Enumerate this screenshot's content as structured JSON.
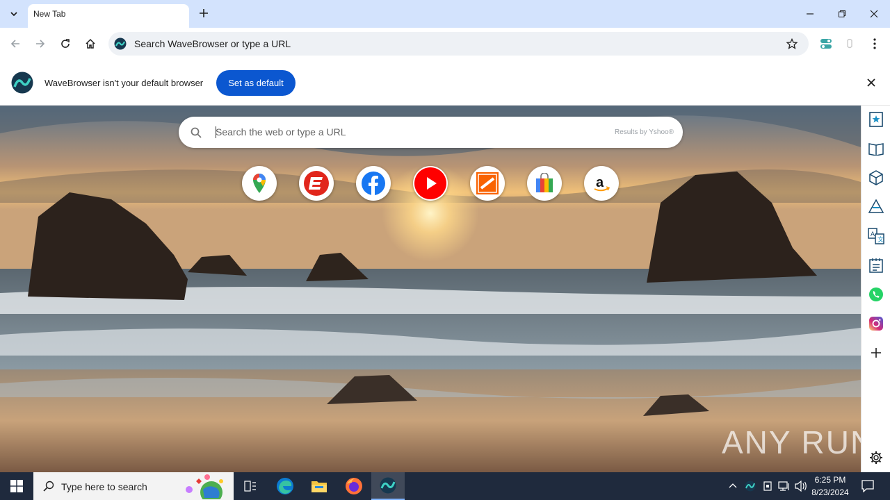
{
  "tab": {
    "title": "New Tab"
  },
  "toolbar": {
    "omnibox_text": "Search WaveBrowser or type a URL"
  },
  "infobar": {
    "message": "WaveBrowser isn't your default browser",
    "button_label": "Set as default"
  },
  "search": {
    "placeholder": "Search the web or type a URL",
    "provider_hint": "Results by Yshoo®"
  },
  "shortcuts": [
    {
      "name": "google-maps",
      "icon": "map-pin-icon"
    },
    {
      "name": "espn",
      "icon": "espn-icon"
    },
    {
      "name": "facebook",
      "icon": "facebook-icon"
    },
    {
      "name": "youtube",
      "icon": "youtube-icon"
    },
    {
      "name": "home-depot",
      "icon": "home-depot-icon"
    },
    {
      "name": "shopping",
      "icon": "shopping-bag-icon"
    },
    {
      "name": "amazon",
      "icon": "amazon-icon"
    }
  ],
  "watermark": "ANY RUN",
  "taskbar": {
    "search_placeholder": "Type here to search",
    "time": "6:25 PM",
    "date": "8/23/2024"
  },
  "colors": {
    "accent": "#0b57d0",
    "tabstrip": "#d3e3fd",
    "taskbar": "#1f2a3d"
  }
}
